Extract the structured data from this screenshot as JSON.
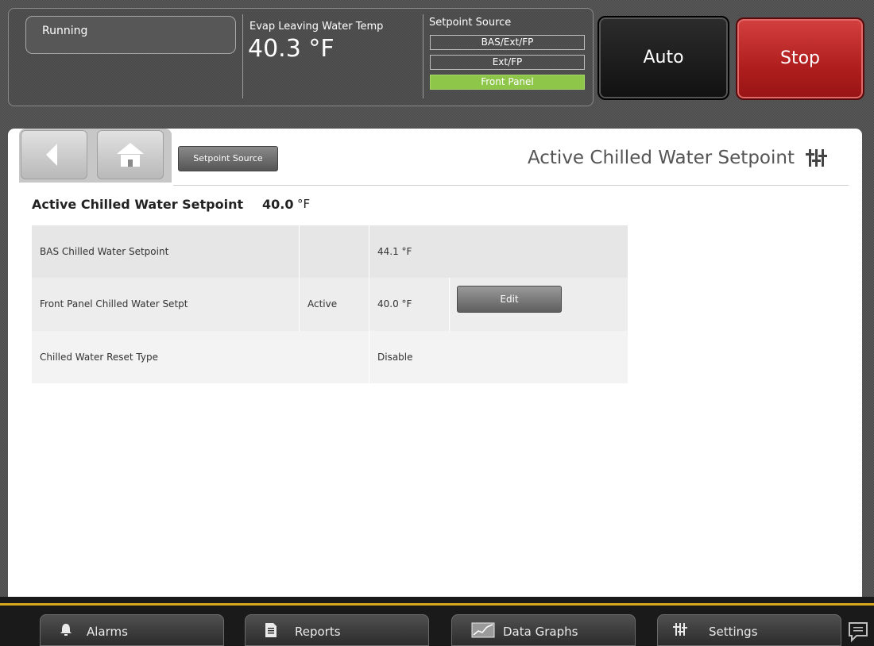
{
  "header": {
    "status": "Running",
    "evap_label": "Evap Leaving Water Temp",
    "evap_value": "40.3 °F",
    "setpoint_source_label": "Setpoint Source",
    "setpoint_source_options": [
      "BAS/Ext/FP",
      "Ext/FP",
      "Front Panel"
    ],
    "setpoint_source_selected": "Front Panel",
    "auto_label": "Auto",
    "stop_label": "Stop"
  },
  "nav": {
    "setpoint_source_button": "Setpoint Source",
    "page_title": "Active Chilled Water Setpoint"
  },
  "summary": {
    "label": "Active Chilled Water Setpoint",
    "value": "40.0",
    "unit": "°F"
  },
  "table": {
    "rows": [
      {
        "name": "BAS Chilled Water Setpoint",
        "status": "",
        "value": "44.1 °F"
      },
      {
        "name": "Front Panel Chilled Water Setpt",
        "status": "Active",
        "value": "40.0 °F",
        "action": "Edit"
      },
      {
        "name": "Chilled Water Reset Type",
        "status": "",
        "value": "Disable"
      }
    ]
  },
  "footer": {
    "alarms": "Alarms",
    "reports": "Reports",
    "data_graphs": "Data Graphs",
    "settings": "Settings"
  },
  "colors": {
    "active_option": "#8ec64a",
    "stop_red": "#b01e1e",
    "footer_accent": "#d8a81c"
  }
}
